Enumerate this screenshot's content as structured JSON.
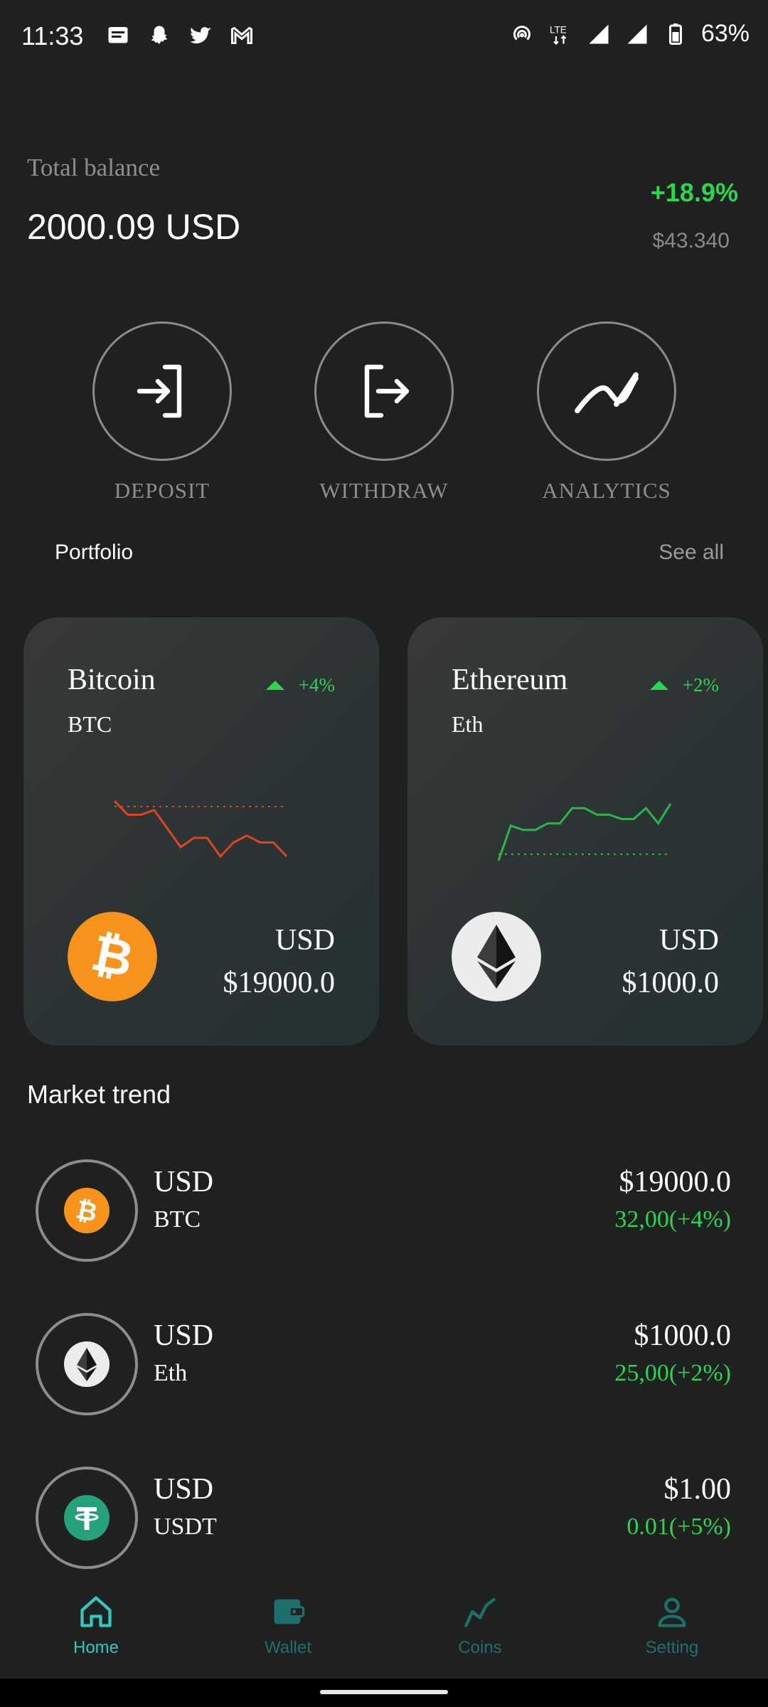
{
  "status_bar": {
    "time": "11:33",
    "network": "LTE",
    "battery": "63%",
    "left_icons": [
      "messages-icon",
      "snapchat-icon",
      "twitter-icon",
      "gmail-icon"
    ],
    "right_icons": [
      "hotspot-icon",
      "lte-icon",
      "signal-icon",
      "signal-icon",
      "battery-icon"
    ]
  },
  "balance": {
    "label": "Total balance",
    "value": "2000.09 USD",
    "change": "+18.9%",
    "usd_value": "$43.340"
  },
  "actions": [
    {
      "label": "DEPOSIT",
      "icon": "login-arrow-icon"
    },
    {
      "label": "WITHDRAW",
      "icon": "logout-arrow-icon"
    },
    {
      "label": "ANALYTICS",
      "icon": "trend-icon"
    }
  ],
  "portfolio": {
    "title": "Portfolio",
    "see_all": "See all",
    "cards": [
      {
        "name": "Bitcoin",
        "symbol": "BTC",
        "change": "+4%",
        "currency": "USD",
        "price": "$19000.0",
        "coin_icon": "bitcoin-icon",
        "spark_color": "#e0431f",
        "sparkline": [
          100,
          94,
          94,
          96,
          88,
          80,
          84,
          84,
          76,
          82,
          85,
          82,
          82,
          76
        ]
      },
      {
        "name": "Ethereum",
        "symbol": "Eth",
        "change": "+2%",
        "currency": "USD",
        "price": "$1000.0",
        "coin_icon": "ethereum-icon",
        "spark_color": "#2bb54a",
        "sparkline": [
          76,
          92,
          90,
          90,
          93,
          93,
          100,
          100,
          97,
          97,
          95,
          95,
          100,
          93,
          102
        ]
      }
    ]
  },
  "market": {
    "title": "Market trend",
    "rows": [
      {
        "currency": "USD",
        "symbol": "BTC",
        "price": "$19000.0",
        "change": "32,00(+4%)",
        "icon": "bitcoin-icon"
      },
      {
        "currency": "USD",
        "symbol": "Eth",
        "price": "$1000.0",
        "change": "25,00(+2%)",
        "icon": "ethereum-icon"
      },
      {
        "currency": "USD",
        "symbol": "USDT",
        "price": "$1.00",
        "change": "0.01(+5%)",
        "icon": "tether-icon"
      }
    ]
  },
  "nav": {
    "items": [
      {
        "label": "Home",
        "icon": "home-icon",
        "active": true
      },
      {
        "label": "Wallet",
        "icon": "wallet-icon",
        "active": false
      },
      {
        "label": "Coins",
        "icon": "coins-chart-icon",
        "active": false
      },
      {
        "label": "Setting",
        "icon": "profile-icon",
        "active": false
      }
    ]
  },
  "colors": {
    "background": "#1f2020",
    "positive": "#2bd64f",
    "negative": "#e0431f",
    "nav_active": "#33c6c0",
    "nav_inactive": "#1e6f6b",
    "bitcoin": "#f7931a",
    "tether": "#26a17b"
  }
}
